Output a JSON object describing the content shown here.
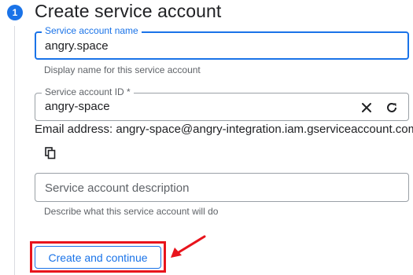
{
  "step": {
    "number": "1",
    "title": "Create service account"
  },
  "fields": {
    "name": {
      "label": "Service account name",
      "value": "angry.space",
      "hint": "Display name for this service account"
    },
    "id": {
      "label": "Service account ID *",
      "value": "angry-space"
    },
    "email": "Email address: angry-space@angry-integration.iam.gserviceaccount.com",
    "description": {
      "placeholder": "Service account description",
      "hint": "Describe what this service account will do"
    }
  },
  "icons": {
    "clear": "close-icon",
    "refresh": "refresh-icon",
    "copy": "copy-icon"
  },
  "actions": {
    "create_label": "Create and continue"
  },
  "colors": {
    "accent": "#1a73e8",
    "annotation": "#e8141c",
    "text": "#202124",
    "secondary_text": "#5f6368",
    "border": "#9aa0a6"
  }
}
